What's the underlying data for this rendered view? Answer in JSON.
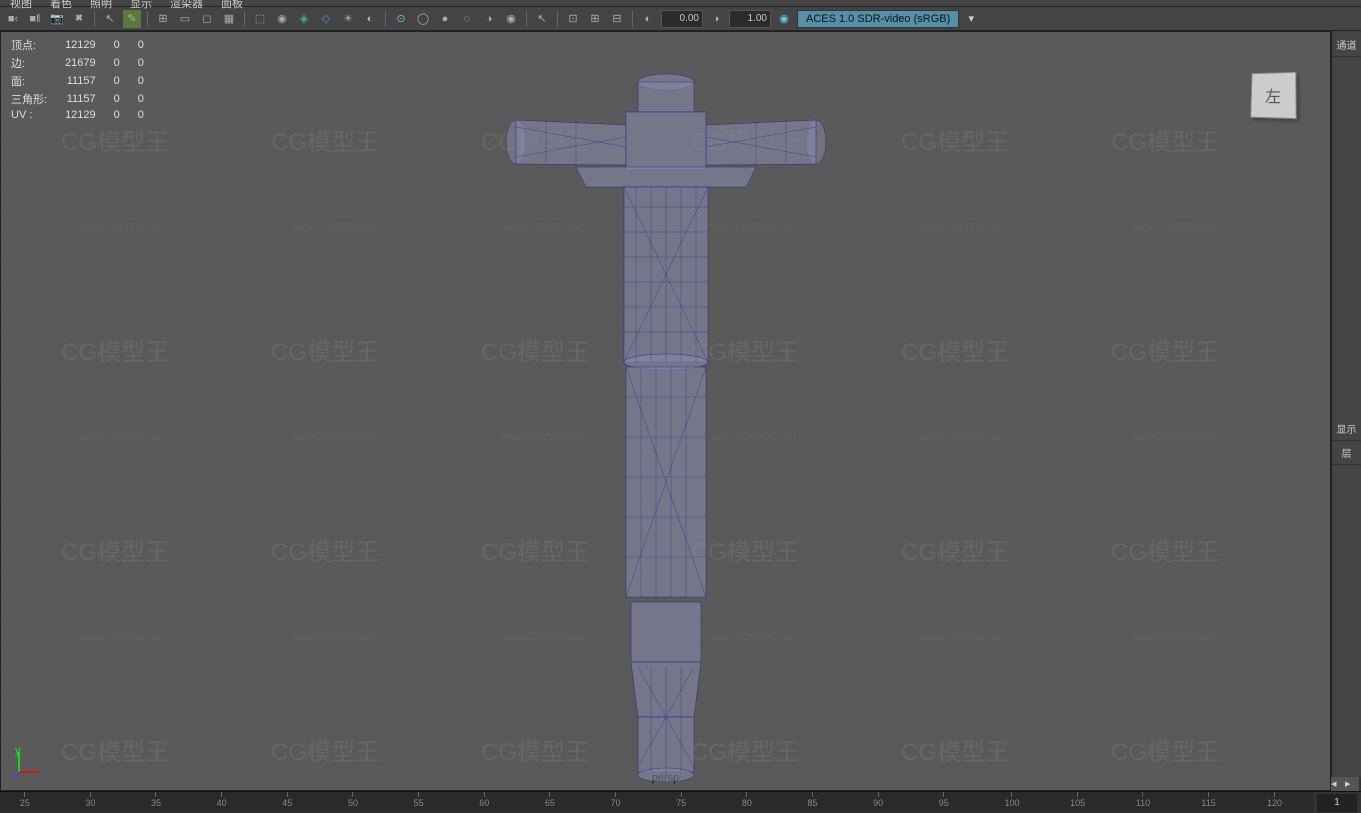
{
  "menubar": {
    "items": [
      "视图",
      "着色",
      "照明",
      "显示",
      "渲染器",
      "面板"
    ]
  },
  "toolbar": {
    "field1": "0.00",
    "field2": "1.00",
    "colorspace": "ACES 1.0 SDR-video (sRGB)"
  },
  "stats": {
    "rows": [
      {
        "label": "顶点:",
        "c1": "12129",
        "c2": "0",
        "c3": "0"
      },
      {
        "label": "边:",
        "c1": "21679",
        "c2": "0",
        "c3": "0"
      },
      {
        "label": "面:",
        "c1": "11157",
        "c2": "0",
        "c3": "0"
      },
      {
        "label": "三角形:",
        "c1": "11157",
        "c2": "0",
        "c3": "0"
      },
      {
        "label": "UV :",
        "c1": "12129",
        "c2": "0",
        "c3": "0"
      }
    ]
  },
  "viewport": {
    "camera": "persp",
    "viewcube_face": "左"
  },
  "right_panel": {
    "tab1": "通道",
    "tab2": "显示",
    "tab3": "层"
  },
  "timeline": {
    "ticks": [
      "25",
      "30",
      "35",
      "40",
      "45",
      "50",
      "55",
      "60",
      "65",
      "70",
      "75",
      "80",
      "85",
      "90",
      "95",
      "100",
      "105",
      "110",
      "115",
      "120"
    ],
    "end_frame": "1"
  },
  "watermark": {
    "logo": "CG模型王",
    "url": "www.CGMXW.com"
  }
}
